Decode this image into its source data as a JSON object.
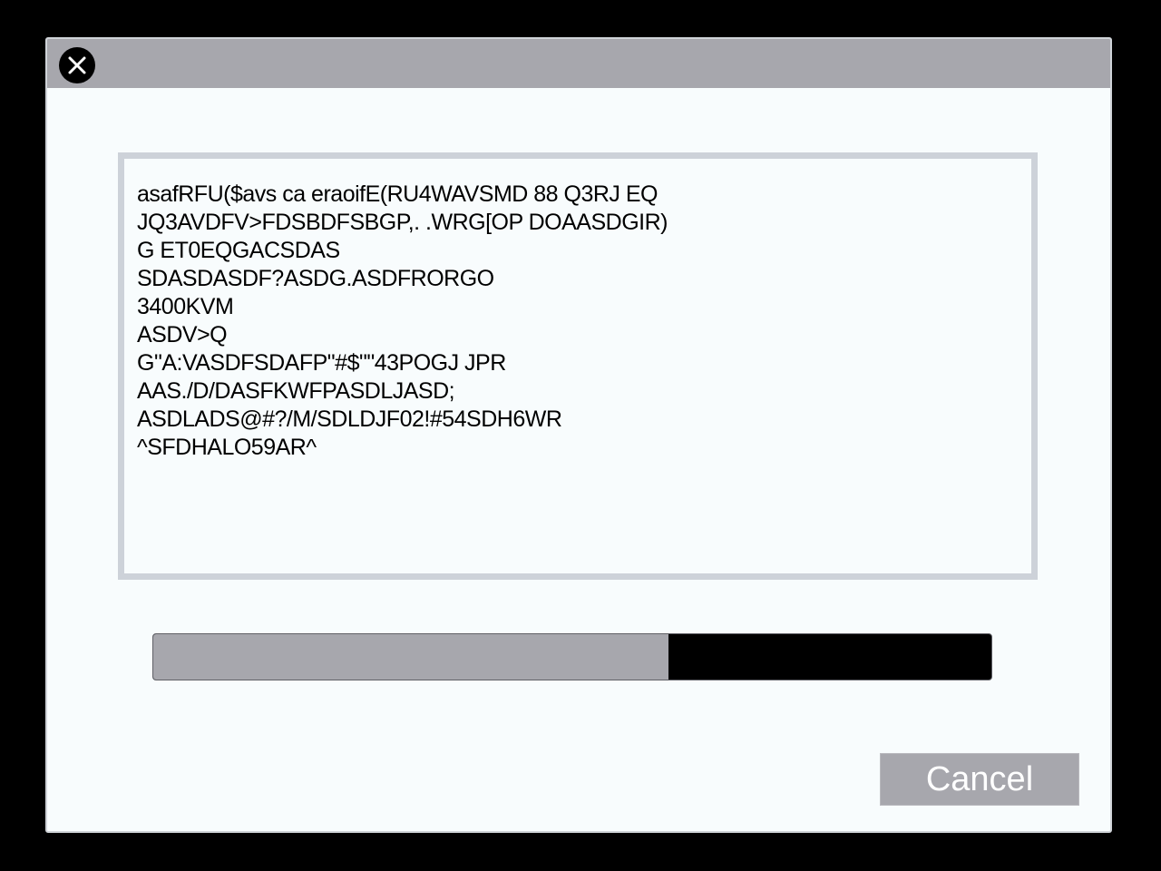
{
  "dialog": {
    "close_icon": "close-icon",
    "text_lines": [
      "asafRFU($avs ca eraoifE(RU4WAVSMD 88 Q3RJ EQ",
      "JQ3AVDFV>FDSBDFSBGP,. .WRG[OP DOAASDGIR)",
      "G ET0EQGACSDAS",
      "SDASDASDF?ASDG.ASDFRORGO",
      "3400KVM",
      "ASDV>Q",
      "G\"A:VASDFSDAFP\"#$\"\"43POGJ JPR",
      "AAS./D/DASFKWFPASDLJASD;",
      "ASDLADS@#?/M/SDLDJF02!#54SDH6WR",
      "^SFDHALO59AR^"
    ],
    "progress": {
      "value": 0.615
    },
    "cancel_label": "Cancel"
  },
  "colors": {
    "titlebar": "#a7a7ad",
    "dialog_background": "#f8fcfd",
    "panel_border": "#cdd2d9",
    "progress_fill": "#a7a7ad",
    "progress_track": "#000000",
    "button_background": "#a7a7ad",
    "button_text": "#ffffff"
  }
}
